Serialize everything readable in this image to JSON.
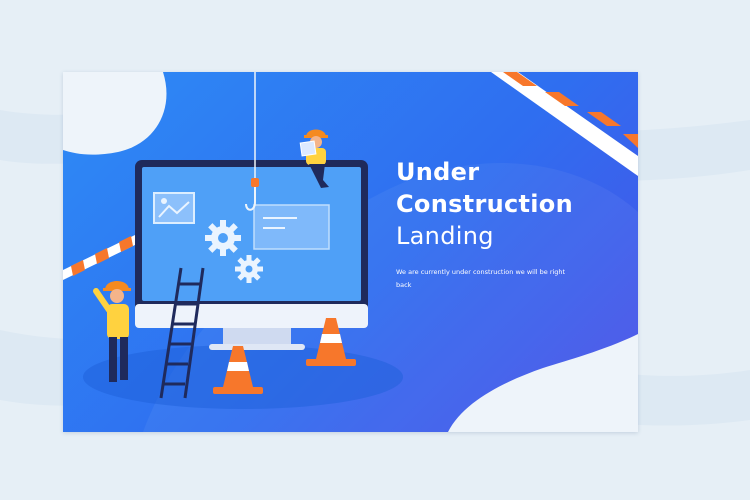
{
  "hero": {
    "title_line1": "Under",
    "title_line2": "Construction",
    "title_line3": "Landing",
    "subtitle": "We are currently under construction we will be right back"
  },
  "colors": {
    "background": "#e6eff6",
    "card_start": "#2e8bf5",
    "card_end": "#4b4fe6",
    "accent_orange": "#f7772b",
    "helmet": "#f58a1f",
    "shirt": "#ffd23f",
    "monitor_frame": "#1f2a5c"
  },
  "icons": [
    "image-icon",
    "gear-icon",
    "document-icon",
    "hook-icon",
    "traffic-cone-icon",
    "ladder-icon",
    "barrier-tape-icon"
  ]
}
